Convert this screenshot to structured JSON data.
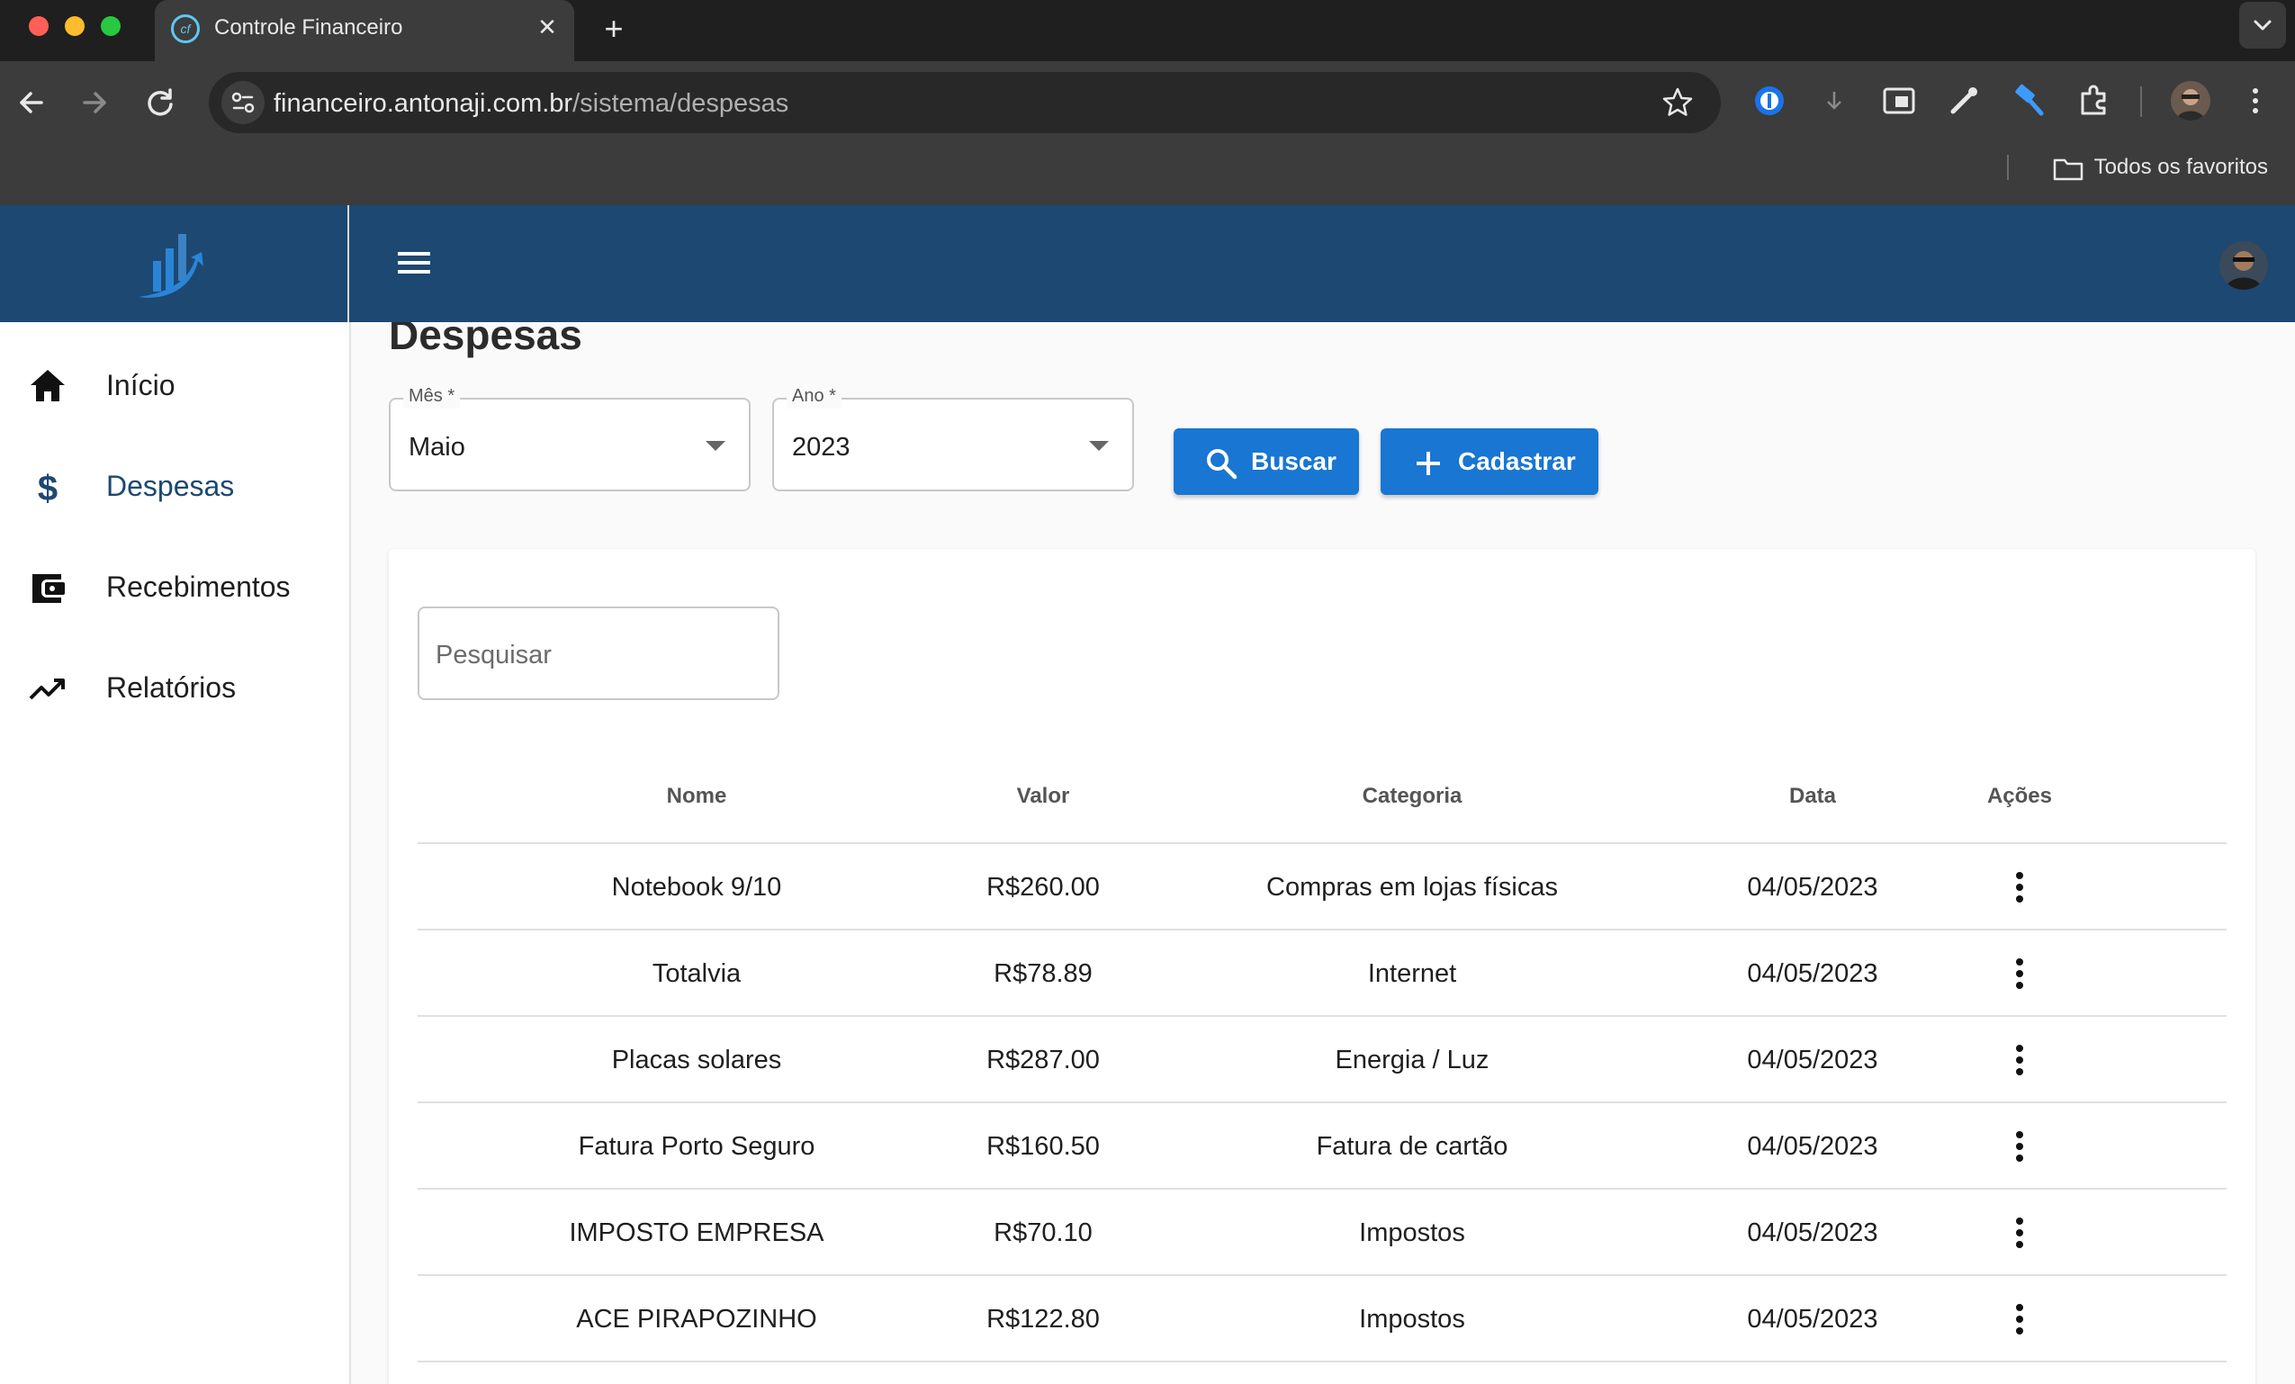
{
  "browser": {
    "tab_title": "Controle Financeiro",
    "url_host": "financeiro.antonaji.com.br",
    "url_path": "/sistema/despesas",
    "bookmarks_label": "Todos os favoritos"
  },
  "sidebar": {
    "items": [
      {
        "label": "Início",
        "icon": "home-icon"
      },
      {
        "label": "Despesas",
        "icon": "dollar-icon"
      },
      {
        "label": "Recebimentos",
        "icon": "wallet-icon"
      },
      {
        "label": "Relatórios",
        "icon": "trending-up-icon"
      }
    ],
    "active_color": "#1d4872"
  },
  "header": {
    "color": "#1d4872"
  },
  "main": {
    "title": "Despesas",
    "filters": {
      "month_label": "Mês *",
      "month_value": "Maio",
      "year_label": "Ano *",
      "year_value": "2023"
    },
    "buttons": {
      "search": "Buscar",
      "create": "Cadastrar"
    },
    "search_placeholder": "Pesquisar",
    "table": {
      "headers": [
        "Nome",
        "Valor",
        "Categoria",
        "Data",
        "Ações"
      ],
      "rows": [
        {
          "nome": "Notebook 9/10",
          "valor": "R$260.00",
          "categoria": "Compras em lojas físicas",
          "data": "04/05/2023"
        },
        {
          "nome": "Totalvia",
          "valor": "R$78.89",
          "categoria": "Internet",
          "data": "04/05/2023"
        },
        {
          "nome": "Placas solares",
          "valor": "R$287.00",
          "categoria": "Energia / Luz",
          "data": "04/05/2023"
        },
        {
          "nome": "Fatura Porto Seguro",
          "valor": "R$160.50",
          "categoria": "Fatura de cartão",
          "data": "04/05/2023"
        },
        {
          "nome": "IMPOSTO EMPRESA",
          "valor": "R$70.10",
          "categoria": "Impostos",
          "data": "04/05/2023"
        },
        {
          "nome": "ACE PIRAPOZINHO",
          "valor": "R$122.80",
          "categoria": "Impostos",
          "data": "04/05/2023"
        }
      ]
    }
  },
  "colors": {
    "primary_button": "#1976d2"
  }
}
